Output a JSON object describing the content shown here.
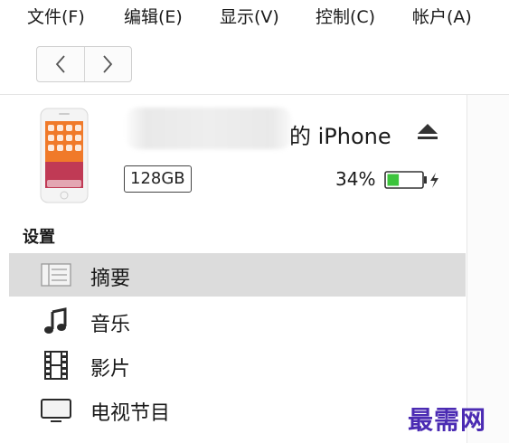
{
  "menubar": {
    "items": [
      "文件(F)",
      "编辑(E)",
      "显示(V)",
      "控制(C)",
      "帐户(A)"
    ]
  },
  "navigation": {
    "back_icon": "chevron-left-icon",
    "forward_icon": "chevron-right-icon"
  },
  "device": {
    "name": "的 iPhone",
    "capacity": "128GB",
    "battery": "34%",
    "battery_level": 0.34,
    "battery_color": "#3cc43c",
    "eject_icon": "eject-icon"
  },
  "sidebar": {
    "section_label": "设置",
    "items": [
      {
        "label": "摘要",
        "icon": "list-icon",
        "selected": true
      },
      {
        "label": "音乐",
        "icon": "music-note-icon",
        "selected": false
      },
      {
        "label": "影片",
        "icon": "film-icon",
        "selected": false
      },
      {
        "label": "电视节目",
        "icon": "tv-icon",
        "selected": false
      }
    ]
  },
  "watermark": "最需网"
}
